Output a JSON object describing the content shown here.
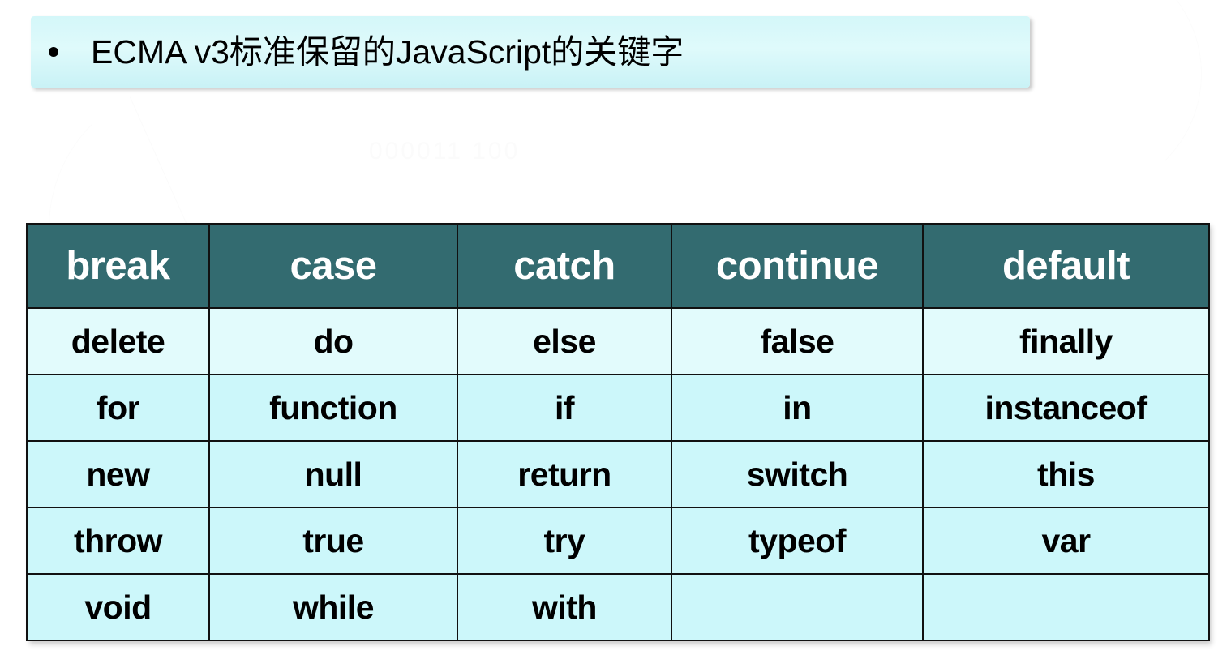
{
  "slide": {
    "title": "ECMA v3标准保留的JavaScript的关键字",
    "bullet_glyph": "•",
    "background_color": "#ffffff",
    "banner_color": "#dcf8fa",
    "watermark_text": "000011 100"
  },
  "keyword_table": {
    "header_background": "#336B70",
    "header_text_color": "#ffffff",
    "cell_background": "#CCF7FA",
    "border_color": "#111111",
    "columns": 5,
    "header": [
      "break",
      "case",
      "catch",
      "continue",
      "default"
    ],
    "rows": [
      [
        "delete",
        "do",
        "else",
        "false",
        "finally"
      ],
      [
        "for",
        "function",
        "if",
        "in",
        "instanceof"
      ],
      [
        "new",
        "null",
        "return",
        "switch",
        "this"
      ],
      [
        "throw",
        "true",
        "try",
        "typeof",
        "var"
      ],
      [
        "void",
        "while",
        "with",
        "",
        ""
      ]
    ]
  }
}
